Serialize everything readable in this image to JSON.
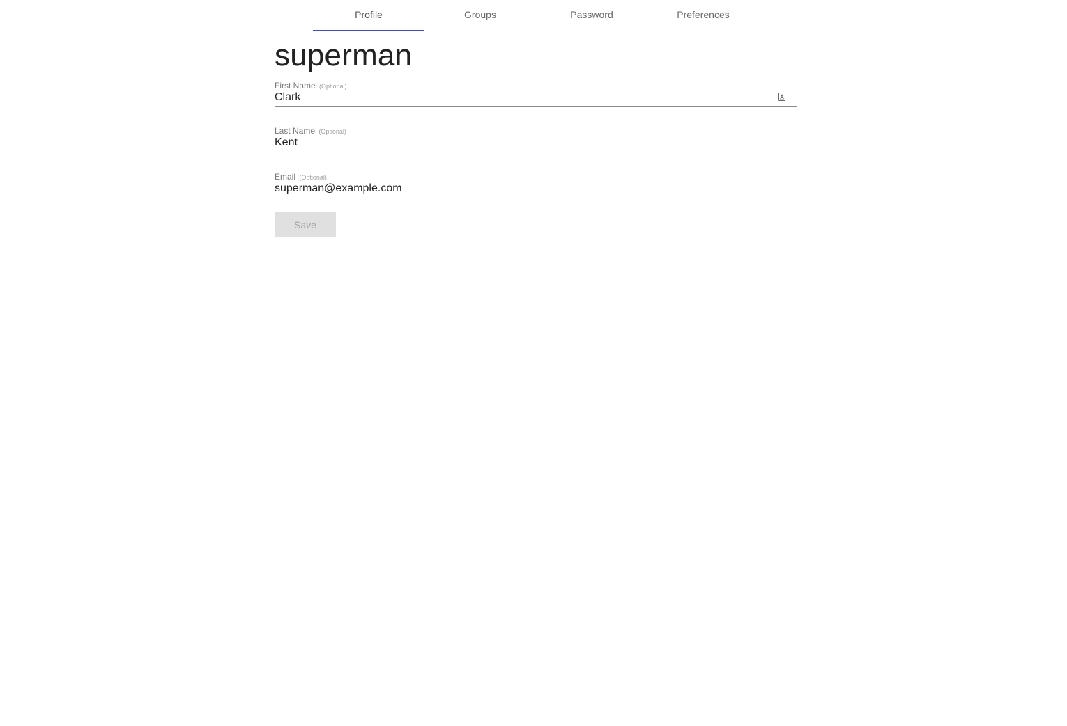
{
  "tabs": [
    {
      "label": "Profile",
      "active": true
    },
    {
      "label": "Groups",
      "active": false
    },
    {
      "label": "Password",
      "active": false
    },
    {
      "label": "Preferences",
      "active": false
    }
  ],
  "colors": {
    "accent": "#3f51b5",
    "text": "#222222",
    "muted": "#7a7a7a",
    "button_bg": "#e0e0e0",
    "button_text": "#a3a3a3"
  },
  "profile": {
    "username": "superman",
    "fields": {
      "first_name": {
        "label": "First Name",
        "optional": "(Optional)",
        "value": "Clark",
        "icon": "autofill-contact-icon"
      },
      "last_name": {
        "label": "Last Name",
        "optional": "(Optional)",
        "value": "Kent"
      },
      "email": {
        "label": "Email",
        "optional": "(Optional)",
        "value": "superman@example.com"
      }
    },
    "save_label": "Save",
    "save_disabled": true
  }
}
